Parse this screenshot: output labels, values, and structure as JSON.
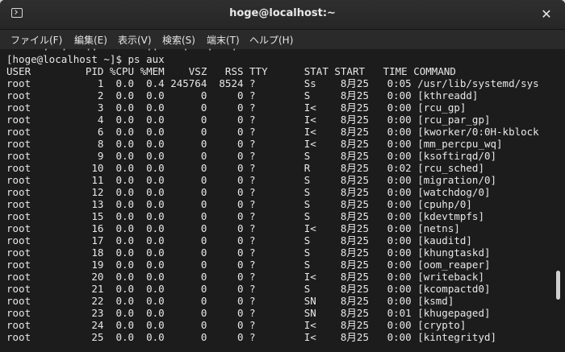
{
  "window": {
    "title": "hoge@localhost:~",
    "close_glyph": "✕"
  },
  "menu": {
    "items": [
      {
        "label": "ファイル(F)"
      },
      {
        "label": "編集(E)"
      },
      {
        "label": "表示(V)"
      },
      {
        "label": "検索(S)"
      },
      {
        "label": "端末(T)"
      },
      {
        "label": "ヘルプ(H)"
      }
    ]
  },
  "terminal": {
    "top_fragment": "      ·  ·   ··        ··    ·   ·   ·",
    "prompt": "[hoge@localhost ~]$ ps aux",
    "header": "USER         PID %CPU %MEM    VSZ   RSS TTY      STAT START   TIME COMMAND",
    "lines": [
      "root           1  0.0  0.4 245764  8524 ?        Ss    8月25   0:05 /usr/lib/systemd/sys",
      "root           2  0.0  0.0      0     0 ?        S     8月25   0:00 [kthreadd]",
      "root           3  0.0  0.0      0     0 ?        I<    8月25   0:00 [rcu_gp]",
      "root           4  0.0  0.0      0     0 ?        I<    8月25   0:00 [rcu_par_gp]",
      "root           6  0.0  0.0      0     0 ?        I<    8月25   0:00 [kworker/0:0H-kblock",
      "root           8  0.0  0.0      0     0 ?        I<    8月25   0:00 [mm_percpu_wq]",
      "root           9  0.0  0.0      0     0 ?        S     8月25   0:00 [ksoftirqd/0]",
      "root          10  0.0  0.0      0     0 ?        R     8月25   0:02 [rcu_sched]",
      "root          11  0.0  0.0      0     0 ?        S     8月25   0:00 [migration/0]",
      "root          12  0.0  0.0      0     0 ?        S     8月25   0:00 [watchdog/0]",
      "root          13  0.0  0.0      0     0 ?        S     8月25   0:00 [cpuhp/0]",
      "root          15  0.0  0.0      0     0 ?        S     8月25   0:00 [kdevtmpfs]",
      "root          16  0.0  0.0      0     0 ?        I<    8月25   0:00 [netns]",
      "root          17  0.0  0.0      0     0 ?        S     8月25   0:00 [kauditd]",
      "root          18  0.0  0.0      0     0 ?        S     8月25   0:00 [khungtaskd]",
      "root          19  0.0  0.0      0     0 ?        S     8月25   0:00 [oom_reaper]",
      "root          20  0.0  0.0      0     0 ?        I<    8月25   0:00 [writeback]",
      "root          21  0.0  0.0      0     0 ?        S     8月25   0:00 [kcompactd0]",
      "root          22  0.0  0.0      0     0 ?        SN    8月25   0:00 [ksmd]",
      "root          23  0.0  0.0      0     0 ?        SN    8月25   0:01 [khugepaged]",
      "root          24  0.0  0.0      0     0 ?        I<    8月25   0:00 [crypto]",
      "root          25  0.0  0.0      0     0 ?        I<    8月25   0:00 [kintegrityd]"
    ]
  }
}
